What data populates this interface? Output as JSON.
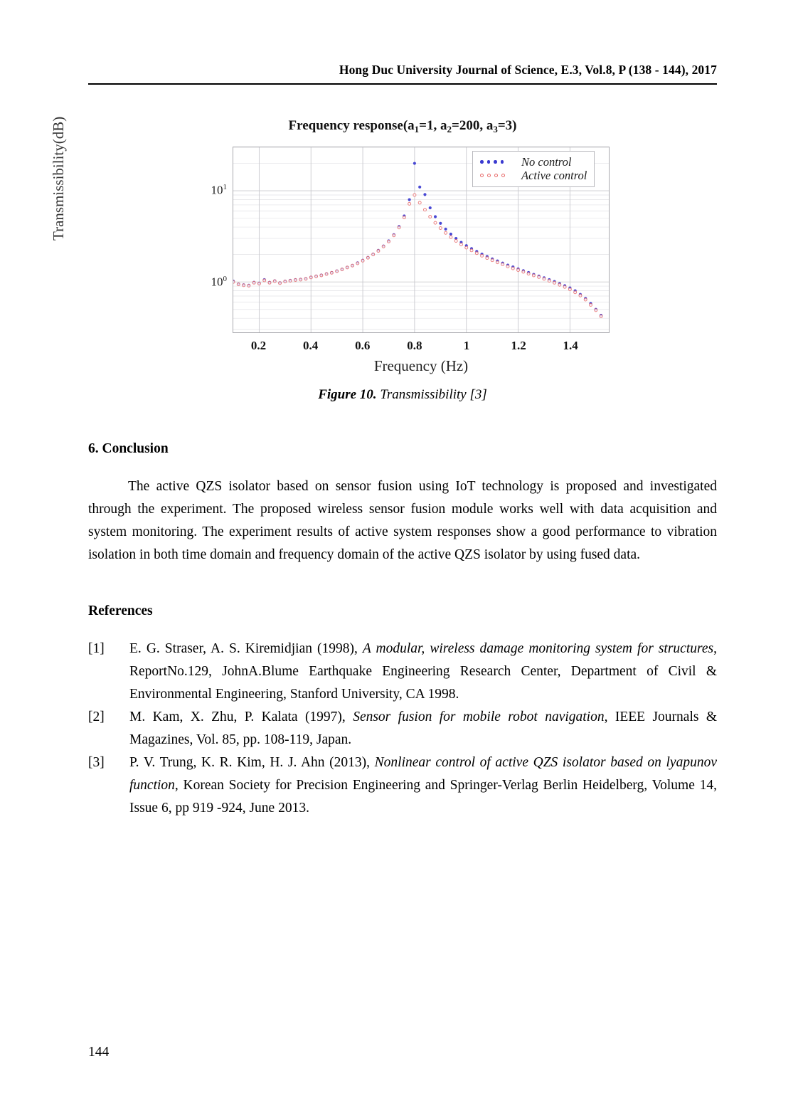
{
  "header": {
    "running_head": "Hong Duc University Journal of Science, E.3, Vol.8, P (138 - 144), 2017"
  },
  "figure": {
    "caption_number": "Figure 10.",
    "caption_text": "Transmissibility [3]"
  },
  "chart_data": {
    "type": "scatter",
    "title": "Frequency response(a₁=1, a₂=200, a₃=3)",
    "title_parts": {
      "prefix": "Frequency response(a",
      "sub1": "1",
      "mid1": "=1, a",
      "sub2": "2",
      "mid2": "=200, a",
      "sub3": "3",
      "suffix": "=3)"
    },
    "xlabel": "Frequency (Hz)",
    "ylabel": "Transmissibility(dB)",
    "yscale": "log",
    "ylim": [
      0.28,
      30
    ],
    "xlim": [
      0.1,
      1.55
    ],
    "xticks": [
      "0.2",
      "0.4",
      "0.6",
      "0.8",
      "1",
      "1.2",
      "1.4"
    ],
    "xtick_values": [
      0.2,
      0.4,
      0.6,
      0.8,
      1.0,
      1.2,
      1.4
    ],
    "yticks": [
      "10⁰",
      "10¹"
    ],
    "ytick_values": [
      1,
      10
    ],
    "grid": true,
    "legend_position": "top-right",
    "colors": {
      "no_control": "#3a3ad0",
      "active_control": "#e86a6a"
    },
    "series": [
      {
        "name": "No control",
        "marker": "filled-circle",
        "color": "#3a3ad0",
        "x": [
          0.1,
          0.12,
          0.14,
          0.16,
          0.18,
          0.2,
          0.22,
          0.24,
          0.26,
          0.28,
          0.3,
          0.32,
          0.34,
          0.36,
          0.38,
          0.4,
          0.42,
          0.44,
          0.46,
          0.48,
          0.5,
          0.52,
          0.54,
          0.56,
          0.58,
          0.6,
          0.62,
          0.64,
          0.66,
          0.68,
          0.7,
          0.72,
          0.74,
          0.76,
          0.78,
          0.8,
          0.82,
          0.84,
          0.86,
          0.88,
          0.9,
          0.92,
          0.94,
          0.96,
          0.98,
          1.0,
          1.02,
          1.04,
          1.06,
          1.08,
          1.1,
          1.12,
          1.14,
          1.16,
          1.18,
          1.2,
          1.22,
          1.24,
          1.26,
          1.28,
          1.3,
          1.32,
          1.34,
          1.36,
          1.38,
          1.4,
          1.42,
          1.44,
          1.46,
          1.48,
          1.5,
          1.52
        ],
        "y": [
          1.02,
          0.95,
          0.93,
          0.92,
          0.99,
          0.97,
          1.06,
          0.99,
          1.03,
          0.98,
          1.02,
          1.04,
          1.06,
          1.07,
          1.09,
          1.13,
          1.16,
          1.19,
          1.23,
          1.27,
          1.32,
          1.38,
          1.45,
          1.52,
          1.62,
          1.73,
          1.86,
          2.02,
          2.22,
          2.48,
          2.82,
          3.3,
          4.05,
          5.3,
          8.0,
          20.0,
          11.0,
          9.1,
          6.5,
          5.2,
          4.4,
          3.8,
          3.35,
          3.0,
          2.72,
          2.5,
          2.32,
          2.16,
          2.02,
          1.9,
          1.79,
          1.7,
          1.61,
          1.53,
          1.46,
          1.39,
          1.33,
          1.27,
          1.21,
          1.16,
          1.11,
          1.06,
          1.01,
          0.96,
          0.91,
          0.86,
          0.8,
          0.73,
          0.66,
          0.58,
          0.5,
          0.43
        ]
      },
      {
        "name": "Active control",
        "marker": "open-circle",
        "color": "#e86a6a",
        "x": [
          0.1,
          0.12,
          0.14,
          0.16,
          0.18,
          0.2,
          0.22,
          0.24,
          0.26,
          0.28,
          0.3,
          0.32,
          0.34,
          0.36,
          0.38,
          0.4,
          0.42,
          0.44,
          0.46,
          0.48,
          0.5,
          0.52,
          0.54,
          0.56,
          0.58,
          0.6,
          0.62,
          0.64,
          0.66,
          0.68,
          0.7,
          0.72,
          0.74,
          0.76,
          0.78,
          0.8,
          0.82,
          0.84,
          0.86,
          0.88,
          0.9,
          0.92,
          0.94,
          0.96,
          0.98,
          1.0,
          1.02,
          1.04,
          1.06,
          1.08,
          1.1,
          1.12,
          1.14,
          1.16,
          1.18,
          1.2,
          1.22,
          1.24,
          1.26,
          1.28,
          1.3,
          1.32,
          1.34,
          1.36,
          1.38,
          1.4,
          1.42,
          1.44,
          1.46,
          1.48,
          1.5,
          1.52
        ],
        "y": [
          1.0,
          0.94,
          0.92,
          0.91,
          0.98,
          0.96,
          1.04,
          0.98,
          1.02,
          0.97,
          1.01,
          1.03,
          1.05,
          1.06,
          1.08,
          1.12,
          1.15,
          1.18,
          1.22,
          1.26,
          1.31,
          1.37,
          1.44,
          1.51,
          1.6,
          1.71,
          1.84,
          2.0,
          2.19,
          2.45,
          2.78,
          3.24,
          3.95,
          5.1,
          7.2,
          9.0,
          7.4,
          6.2,
          5.2,
          4.45,
          3.9,
          3.45,
          3.1,
          2.82,
          2.58,
          2.38,
          2.22,
          2.07,
          1.94,
          1.83,
          1.73,
          1.64,
          1.56,
          1.48,
          1.41,
          1.35,
          1.29,
          1.23,
          1.18,
          1.13,
          1.08,
          1.03,
          0.98,
          0.93,
          0.88,
          0.83,
          0.77,
          0.71,
          0.64,
          0.56,
          0.49,
          0.42
        ]
      }
    ]
  },
  "conclusion": {
    "heading": "6. Conclusion",
    "paragraph": "The active QZS isolator based on sensor fusion using IoT technology is proposed and investigated through the experiment. The proposed wireless sensor fusion module works well with data acquisition and system monitoring. The experiment results of active system responses show a good performance to vibration isolation in both time domain and frequency domain of the active QZS isolator by using fused data."
  },
  "references": {
    "heading": "References",
    "items": [
      {
        "number": "[1]",
        "pre": "E. G. Straser, A. S. Kiremidjian (1998), ",
        "italic": "A modular, wireless damage monitoring system for structures",
        "post": ", ReportNo.129, JohnA.Blume Earthquake Engineering Research Center, Department of Civil & Environmental Engineering, Stanford University, CA 1998."
      },
      {
        "number": "[2]",
        "pre": "M. Kam, X. Zhu, P. Kalata (1997), ",
        "italic": "Sensor fusion for mobile robot navigation",
        "post": ", IEEE Journals & Magazines, Vol. 85, pp. 108-119, Japan."
      },
      {
        "number": "[3]",
        "pre": "P. V. Trung, K. R. Kim, H. J. Ahn (2013), ",
        "italic": "Nonlinear control of active QZS isolator based on lyapunov function",
        "post": ", Korean Society for Precision Engineering and Springer-Verlag Berlin Heidelberg, Volume 14, Issue 6, pp 919 -924, June 2013."
      }
    ]
  },
  "footer": {
    "page_number": "144"
  }
}
